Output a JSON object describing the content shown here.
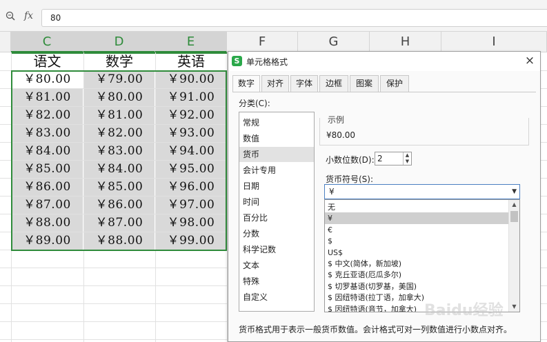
{
  "formula_bar": {
    "fx_label": "fx",
    "value": "80"
  },
  "columns": [
    "C",
    "D",
    "E",
    "F",
    "G",
    "H",
    "I"
  ],
  "table": {
    "headers": [
      "语文",
      "数学",
      "英语"
    ],
    "rows": [
      [
        "￥80.00",
        "￥79.00",
        "￥90.00"
      ],
      [
        "￥81.00",
        "￥80.00",
        "￥91.00"
      ],
      [
        "￥82.00",
        "￥81.00",
        "￥92.00"
      ],
      [
        "￥83.00",
        "￥82.00",
        "￥93.00"
      ],
      [
        "￥84.00",
        "￥83.00",
        "￥94.00"
      ],
      [
        "￥85.00",
        "￥84.00",
        "￥95.00"
      ],
      [
        "￥86.00",
        "￥85.00",
        "￥96.00"
      ],
      [
        "￥87.00",
        "￥86.00",
        "￥97.00"
      ],
      [
        "￥88.00",
        "￥87.00",
        "￥98.00"
      ],
      [
        "￥89.00",
        "￥88.00",
        "￥99.00"
      ]
    ]
  },
  "dialog": {
    "app_icon": "S",
    "title": "单元格格式",
    "close": "×",
    "tabs": [
      "数字",
      "对齐",
      "字体",
      "边框",
      "图案",
      "保护"
    ],
    "category_label": "分类(C):",
    "categories": [
      "常规",
      "数值",
      "货币",
      "会计专用",
      "日期",
      "时间",
      "百分比",
      "分数",
      "科学记数",
      "文本",
      "特殊",
      "自定义"
    ],
    "selected_category": "货币",
    "sample_label": "示例",
    "sample_value": "¥80.00",
    "decimal_label": "小数位数(D):",
    "decimal_value": "2",
    "currency_label": "货币符号(S):",
    "currency_selected": "¥",
    "currency_options": [
      "无",
      "¥",
      "€",
      "$",
      "US$",
      "$ 中文(简体，新加坡)",
      "$ 克丘亚语(厄瓜多尔)",
      "$ 切罗基语(切罗基，美国)",
      "$ 因纽特语(拉丁语，加拿大)",
      "$ 因纽特语(音节，加拿大)"
    ],
    "description": "货币格式用于表示一般货币数值。会计格式可对一列数值进行小数点对齐。"
  },
  "watermark": "Baidu经验"
}
